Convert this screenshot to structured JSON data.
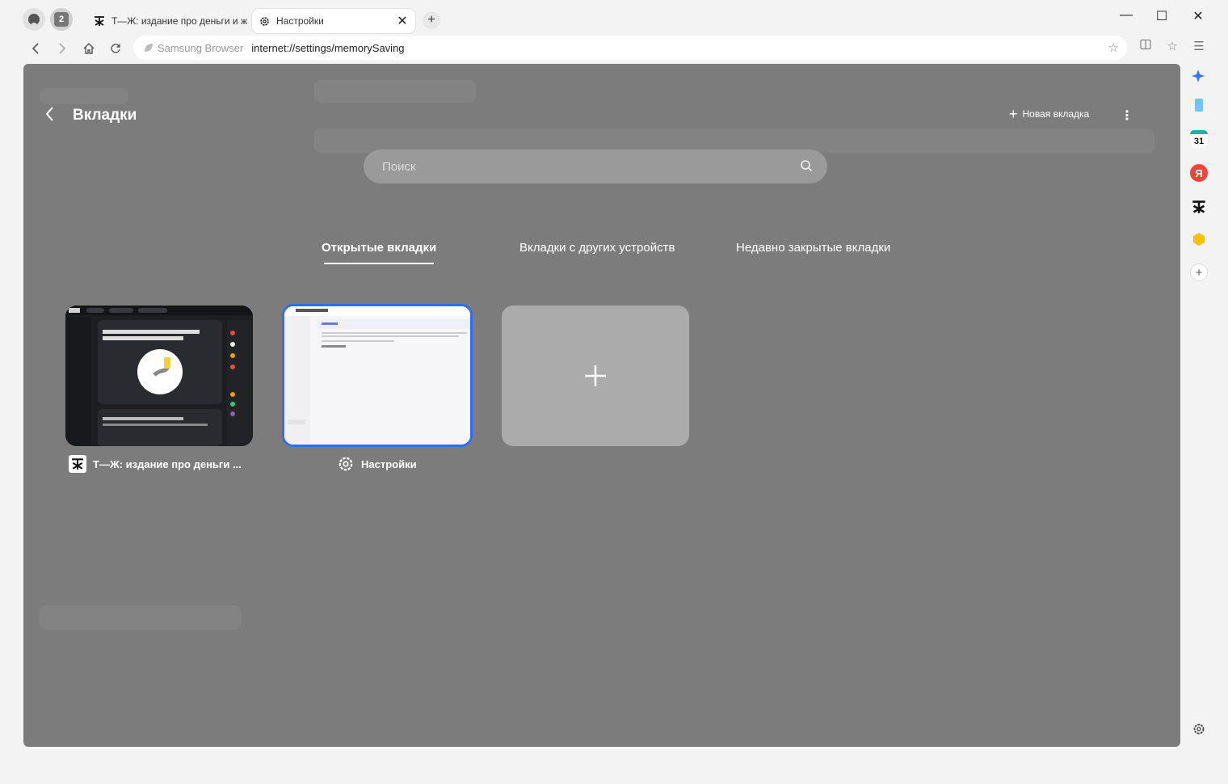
{
  "browser": {
    "tabs": [
      {
        "title": "Т—Ж: издание про деньги и ж",
        "favicon": "tzh-logo-icon"
      },
      {
        "title": "Настройки",
        "favicon": "gear-icon"
      }
    ],
    "tab_count_badge": "2",
    "address_brand": "Samsung Browser",
    "url": "internet://settings/memorySaving"
  },
  "tab_manager": {
    "title": "Вкладки",
    "new_tab_label": "Новая вкладка",
    "search_placeholder": "Поиск",
    "sections": [
      {
        "label": "Открытые вкладки",
        "active": true
      },
      {
        "label": "Вкладки с других устройств",
        "active": false
      },
      {
        "label": "Недавно закрытые вкладки",
        "active": false
      }
    ],
    "cards": [
      {
        "title": "Т—Ж: издание про деньги ...",
        "icon": "tzh-logo-icon"
      },
      {
        "title": "Настройки",
        "icon": "gear-icon"
      }
    ]
  },
  "sidebar": {
    "calendar_day": "31",
    "yandex_letter": "Я"
  },
  "colors": {
    "accent": "#2f6bff",
    "overlay": "#7c7c7c"
  }
}
